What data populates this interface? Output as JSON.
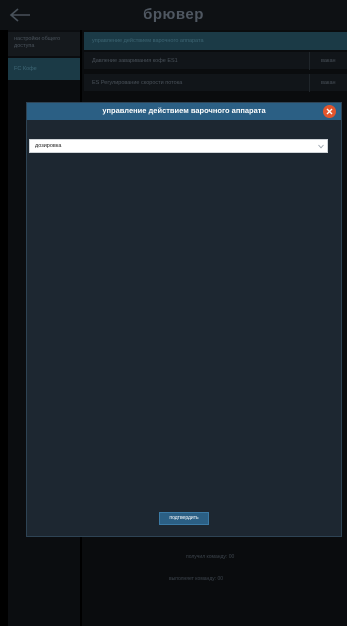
{
  "app": {
    "title": "брювер",
    "icons": {
      "back": "arrow-left-icon"
    }
  },
  "sidebar": {
    "items": [
      {
        "label": "настройки общего доступа"
      },
      {
        "label": "FC Кофе",
        "active": true
      }
    ]
  },
  "content": {
    "header": "управление действием варочного аппарата",
    "rows": [
      {
        "label": "Давление заваривания кофе ES1",
        "value": "вакан"
      },
      {
        "label": "ES Регулирование скорости потока",
        "value": "вакан"
      }
    ],
    "stats": [
      {
        "label": "получил команду: 00"
      },
      {
        "label": "выполняет команду: 00"
      }
    ]
  },
  "modal": {
    "title": "управление действием варочного аппарата",
    "close_icon": "close-circle-icon",
    "select": {
      "value": "дозировка",
      "icon": "chevron-down-icon"
    },
    "confirm_label": "подтвердить"
  },
  "colors": {
    "modal_header": "#2b5f84",
    "modal_body": "#1d2731",
    "close_button": "#e3562d",
    "background": "#000000"
  }
}
